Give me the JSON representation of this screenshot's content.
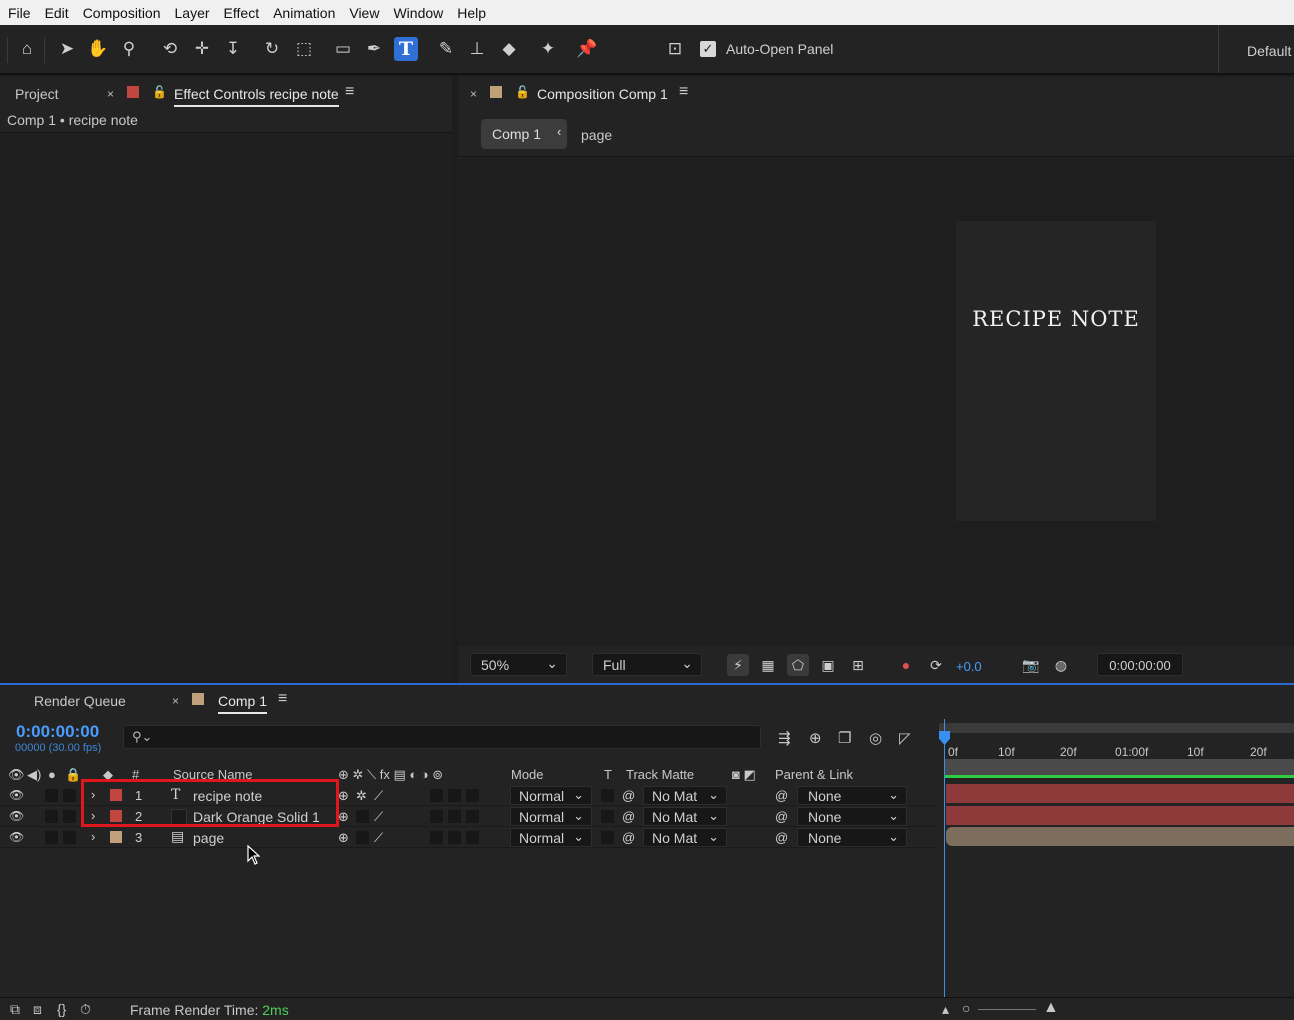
{
  "menu": [
    "File",
    "Edit",
    "Composition",
    "Layer",
    "Effect",
    "Animation",
    "View",
    "Window",
    "Help"
  ],
  "toolbar": {
    "auto_open_label": "Auto-Open Panel",
    "workspace_label": "Default",
    "tools": [
      "home-icon",
      "selection-tool-icon",
      "hand-tool-icon",
      "zoom-tool-icon",
      "orbit-camera-icon",
      "pan-camera-icon",
      "dolly-camera-icon",
      "rotation-tool-icon",
      "pan-behind-icon",
      "rectangle-tool-icon",
      "pen-tool-icon",
      "type-tool-icon",
      "brush-tool-icon",
      "clone-stamp-icon",
      "eraser-tool-icon",
      "roto-brush-icon",
      "puppet-pin-icon"
    ],
    "type_tool_label": "T"
  },
  "left_panel": {
    "tab_project": "Project",
    "tab_effect_controls": "Effect Controls recipe note",
    "subheader": "Comp 1 • recipe note"
  },
  "comp_panel": {
    "tab_label": "Composition Comp 1",
    "breadcrumb_active": "Comp 1",
    "breadcrumb_next": "page",
    "canvas_text": "RECIPE NOTE",
    "zoom": "50%",
    "resolution": "Full",
    "exposure": "+0.0",
    "timecode": "0:00:00:00"
  },
  "timeline": {
    "tab_render_queue": "Render Queue",
    "tab_comp": "Comp 1",
    "current_time": "0:00:00:00",
    "fps_info": "00000 (30.00 fps)",
    "search_placeholder": "",
    "headers": {
      "number": "#",
      "source_name": "Source Name",
      "mode": "Mode",
      "t": "T",
      "track_matte": "Track Matte",
      "parent": "Parent & Link"
    },
    "layers": [
      {
        "num": "1",
        "name": "recipe note",
        "type_icon": "T",
        "label_color": "#c0463f",
        "mode": "Normal",
        "matte": "No Mat",
        "parent": "None",
        "bar_color": "#8e3a3a"
      },
      {
        "num": "2",
        "name": "Dark Orange Solid 1",
        "type_icon": "",
        "label_color": "#c0463f",
        "mode": "Normal",
        "matte": "No Mat",
        "parent": "None",
        "bar_color": "#8e3a3a"
      },
      {
        "num": "3",
        "name": "page",
        "type_icon": "▤",
        "label_color": "#bfa07a",
        "mode": "Normal",
        "matte": "No Mat",
        "parent": "None",
        "bar_color": "#7d6d5c"
      }
    ],
    "ruler_labels": [
      "0f",
      "10f",
      "20f",
      "01:00f",
      "10f",
      "20f"
    ],
    "frame_render_label": "Frame Render Time:",
    "frame_render_value": "2ms"
  },
  "colors": {
    "accent_blue": "#2f6fd6",
    "timecode_blue": "#4a9cff",
    "highlight_red": "#e0161d",
    "green": "#4ed05a"
  }
}
